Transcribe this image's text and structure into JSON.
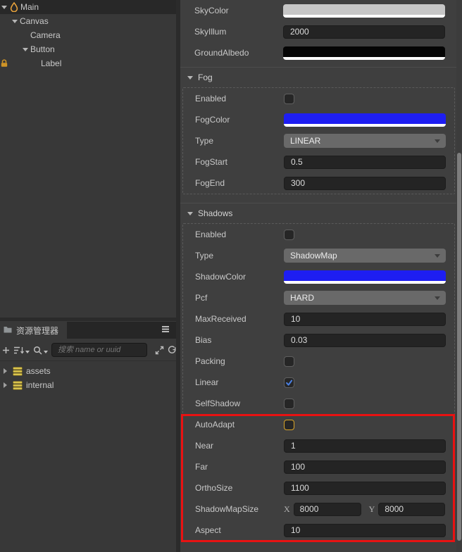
{
  "colors": {
    "annotation_red": "#e81212",
    "focus_orange": "#d9a528",
    "check_blue": "#4a7fe0",
    "fog_blue": "#1e1ef2",
    "sky_color": "#c6c6c6",
    "ground_albedo": "#050505",
    "asset_icon_yellow": "#d9c34c",
    "scene_icon_orange": "#e8a23c",
    "lock_orange": "#cf9426"
  },
  "hierarchy": {
    "items": [
      {
        "label": "Main",
        "level": 0,
        "arrow": "down",
        "icon": "droplet",
        "root": true
      },
      {
        "label": "Canvas",
        "level": 1,
        "arrow": "down"
      },
      {
        "label": "Camera",
        "level": 2
      },
      {
        "label": "Button",
        "level": 2,
        "arrow": "down"
      },
      {
        "label": "Label",
        "level": 3,
        "lock": true
      }
    ]
  },
  "assets_panel": {
    "tab_label": "资源管理器",
    "search_placeholder": "搜索 name or uuid",
    "items": [
      {
        "label": "assets"
      },
      {
        "label": "internal"
      }
    ]
  },
  "inspector": {
    "top_rows": [
      {
        "kind": "color",
        "label": "SkyColor",
        "color": "#c6c6c6"
      },
      {
        "kind": "input",
        "label": "SkyIllum",
        "value": "2000"
      },
      {
        "kind": "color",
        "label": "GroundAlbedo",
        "color": "#050505"
      }
    ],
    "sections": [
      {
        "label": "Fog",
        "rows": [
          {
            "kind": "checkbox",
            "label": "Enabled",
            "checked": false
          },
          {
            "kind": "color",
            "label": "FogColor",
            "color": "#1e1ef2"
          },
          {
            "kind": "select",
            "label": "Type",
            "value": "LINEAR"
          },
          {
            "kind": "input",
            "label": "FogStart",
            "value": "0.5"
          },
          {
            "kind": "input",
            "label": "FogEnd",
            "value": "300"
          }
        ]
      },
      {
        "label": "Shadows",
        "rows": [
          {
            "kind": "checkbox",
            "label": "Enabled",
            "checked": false
          },
          {
            "kind": "select",
            "label": "Type",
            "value": "ShadowMap"
          },
          {
            "kind": "color",
            "label": "ShadowColor",
            "color": "#1e1ef2"
          },
          {
            "kind": "select",
            "label": "Pcf",
            "value": "HARD"
          },
          {
            "kind": "input",
            "label": "MaxReceived",
            "value": "10"
          },
          {
            "kind": "input",
            "label": "Bias",
            "value": "0.03"
          },
          {
            "kind": "checkbox",
            "label": "Packing",
            "checked": false
          },
          {
            "kind": "checkbox",
            "label": "Linear",
            "checked": true
          },
          {
            "kind": "checkbox",
            "label": "SelfShadow",
            "checked": false
          },
          {
            "kind": "checkbox",
            "label": "AutoAdapt",
            "checked": false,
            "highlight": true
          },
          {
            "kind": "input",
            "label": "Near",
            "value": "1"
          },
          {
            "kind": "input",
            "label": "Far",
            "value": "100"
          },
          {
            "kind": "input",
            "label": "OrthoSize",
            "value": "1100"
          },
          {
            "kind": "vec2",
            "label": "ShadowMapSize",
            "axis_labels": [
              "X",
              "Y"
            ],
            "x": "8000",
            "y": "8000"
          },
          {
            "kind": "input",
            "label": "Aspect",
            "value": "10"
          }
        ]
      }
    ]
  }
}
